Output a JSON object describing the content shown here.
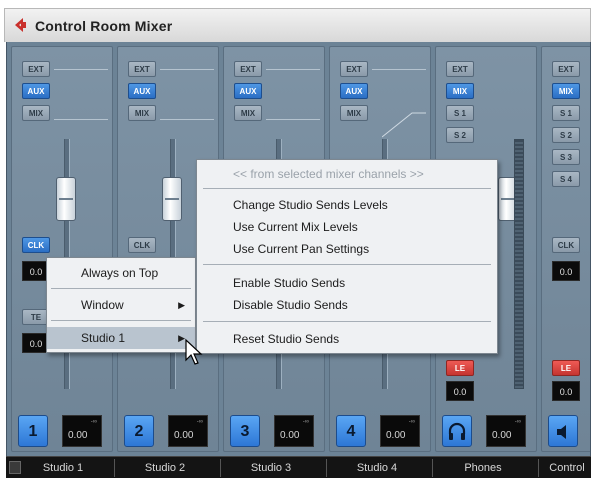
{
  "window": {
    "title": "Control Room Mixer",
    "accent": "#c9302c"
  },
  "colors": {
    "mixer_bg": "#6c8396",
    "active_button": "#2a6ec4",
    "listen_button": "#d6453f"
  },
  "strips": [
    {
      "number": "1",
      "buttons": [
        "EXT",
        "AUX",
        "MIX"
      ],
      "active": "AUX",
      "readout": "0.00",
      "clk": "CLK",
      "small_readout": "0.0",
      "bottom": "Studio 1"
    },
    {
      "number": "2",
      "buttons": [
        "EXT",
        "AUX",
        "MIX"
      ],
      "active": "AUX",
      "readout": "0.00",
      "clk": "CLK",
      "bottom": "Studio 2"
    },
    {
      "number": "3",
      "buttons": [
        "EXT",
        "AUX",
        "MIX"
      ],
      "active": "AUX",
      "readout": "0.00",
      "bottom": "Studio 3"
    },
    {
      "number": "4",
      "buttons": [
        "EXT",
        "AUX",
        "MIX"
      ],
      "active": "AUX",
      "readout": "0.00",
      "bottom": "Studio 4"
    },
    {
      "icon": "headphones-icon",
      "buttons": [
        "EXT",
        "MIX",
        "S 1",
        "S 2"
      ],
      "active": "MIX",
      "readout": "0.00",
      "le": "LE",
      "le_readout": "0.0",
      "bottom": "Phones"
    },
    {
      "icon": "speaker-icon",
      "buttons": [
        "EXT",
        "MIX",
        "S 1",
        "S 2",
        "S 3",
        "S 4"
      ],
      "active": "MIX",
      "clk": "CLK",
      "small_readout": "0.0",
      "le": "LE",
      "le_readout": "0.0",
      "bottom": "Control"
    }
  ],
  "partial_labels": {
    "strip1_small": "TE",
    "strip1_lower": "0.0"
  },
  "context_menu_left": {
    "items": [
      "Always on Top",
      "Window",
      "Studio 1"
    ],
    "highlighted": "Studio 1"
  },
  "context_menu_right": {
    "header": "<< from selected mixer channels >>",
    "group1": [
      "Change Studio Sends Levels",
      "Use Current Mix Levels",
      "Use Current Pan Settings"
    ],
    "group2": [
      "Enable Studio Sends",
      "Disable Studio Sends"
    ],
    "group3": [
      "Reset Studio Sends"
    ]
  }
}
